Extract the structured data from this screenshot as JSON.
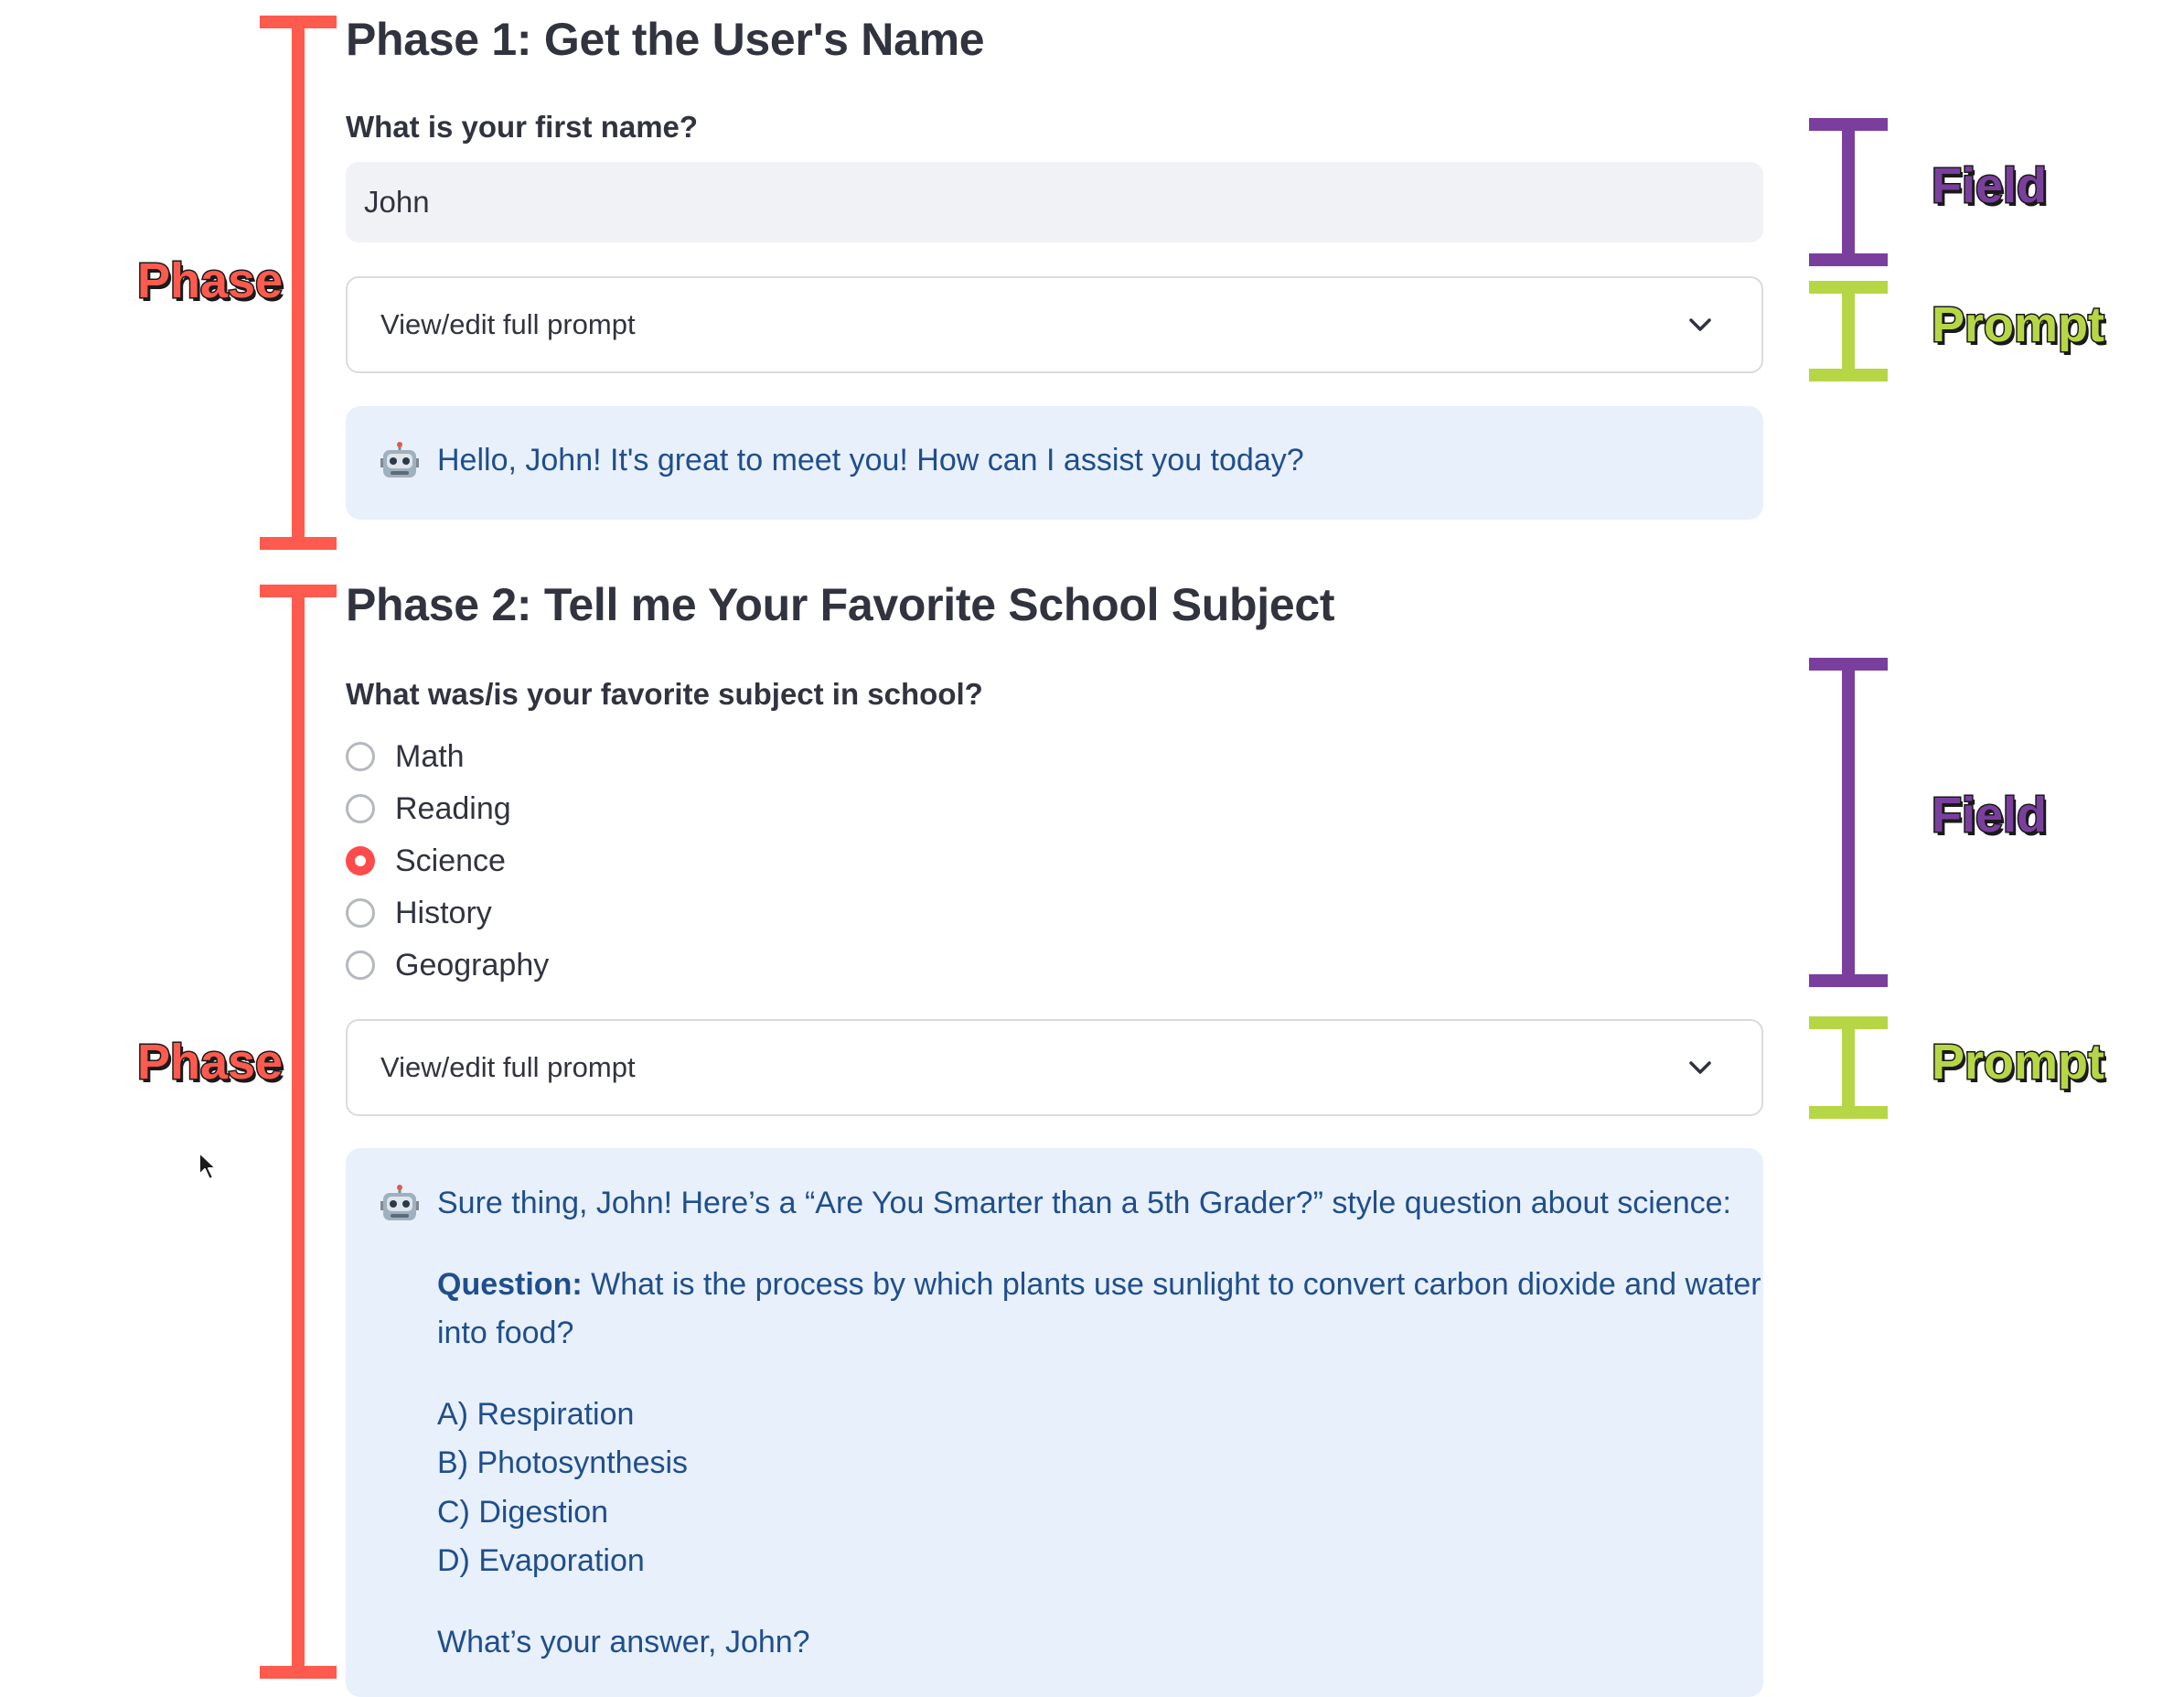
{
  "phase1": {
    "heading": "Phase 1: Get the User's Name",
    "field_label": "What is your first name?",
    "input_value": "John",
    "expander_label": "View/edit full prompt",
    "response": "Hello, John! It's great to meet you! How can I assist you today?"
  },
  "phase2": {
    "heading": "Phase 2: Tell me Your Favorite School Subject",
    "field_label": "What was/is your favorite subject in school?",
    "options": [
      "Math",
      "Reading",
      "Science",
      "History",
      "Geography"
    ],
    "selected": "Science",
    "expander_label": "View/edit full prompt",
    "response": {
      "intro": "Sure thing, John! Here’s a “Are You Smarter than a 5th Grader?” style question about science:",
      "question_label": "Question:",
      "question_line1": " What is the process by which plants use sunlight to convert carbon dioxide and water",
      "question_line2": "into food?",
      "answers": [
        "A) Respiration",
        "B) Photosynthesis",
        "C) Digestion",
        "D) Evaporation"
      ],
      "closing": "What’s your answer, John?"
    }
  },
  "annotations": {
    "phase_label": "Phase",
    "field_label": "Field",
    "prompt_label": "Prompt",
    "colors": {
      "phase": "#ff5a4e",
      "field": "#7a3f9d",
      "prompt": "#b7d645"
    }
  },
  "icons": {
    "bot": "robot-icon",
    "expander": "chevron-down-icon",
    "cursor": "mouse-pointer-icon"
  }
}
